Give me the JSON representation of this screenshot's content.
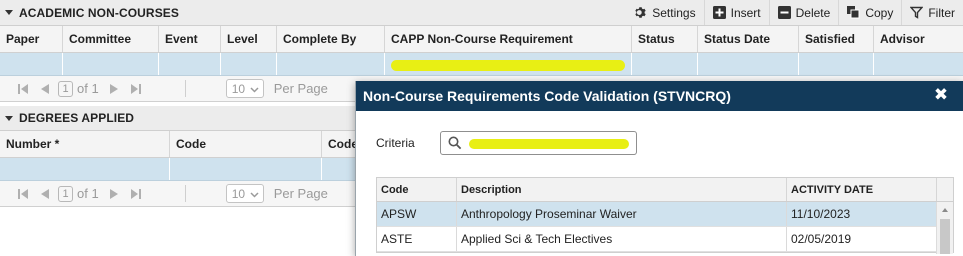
{
  "toolbar": {
    "settings": "Settings",
    "insert": "Insert",
    "delete": "Delete",
    "copy": "Copy",
    "filter": "Filter"
  },
  "academic_non_courses": {
    "title": "ACADEMIC NON-COURSES",
    "columns": [
      "Paper",
      "Committee",
      "Event",
      "Level",
      "Complete By",
      "CAPP Non-Course Requirement",
      "Status",
      "Status Date",
      "Satisfied",
      "Advisor"
    ],
    "pager": {
      "page": "1",
      "of_label": "of 1",
      "page_size": "10",
      "per_page_label": "Per Page"
    }
  },
  "degrees_applied": {
    "title": "DEGREES APPLIED",
    "columns": [
      "Number *",
      "Code",
      "Code"
    ],
    "pager": {
      "page": "1",
      "of_label": "of 1",
      "page_size": "10",
      "per_page_label": "Per Page"
    }
  },
  "modal": {
    "title": "Non-Course Requirements Code Validation (STVNCRQ)",
    "criteria_label": "Criteria",
    "columns": [
      "Code",
      "Description",
      "ACTIVITY DATE"
    ],
    "rows": [
      {
        "code": "APSW",
        "description": "Anthropology Proseminar Waiver",
        "date": "11/10/2023"
      },
      {
        "code": "ASTE",
        "description": "Applied Sci & Tech Electives",
        "date": "02/05/2019"
      }
    ]
  },
  "colors": {
    "modal_header": "#123a5a",
    "selected_row": "#cfe2ee",
    "highlight": "#e8ef14"
  }
}
